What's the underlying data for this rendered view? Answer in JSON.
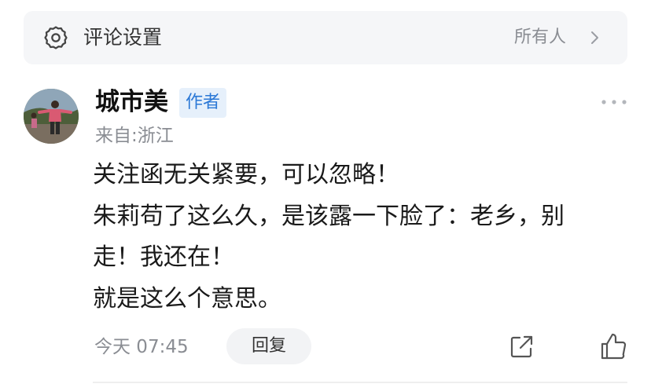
{
  "settings": {
    "label": "评论设置",
    "value": "所有人",
    "icon": "gear-icon",
    "chevron": "chevron-right-icon"
  },
  "comment": {
    "author": "城市美",
    "badge": "作者",
    "location": "来自:浙江",
    "lines": [
      "关注函无关紧要，可以忽略！",
      "朱莉苟了这么久，是该露一下脸了：老乡，别",
      "走！我还在！",
      "就是这么个意思。"
    ],
    "time": "今天 07:45",
    "reply_label": "回复",
    "more_icon": "more-dots-icon",
    "share_icon": "share-icon",
    "like_icon": "thumbs-up-icon"
  },
  "colors": {
    "badge_bg": "#e6f0fb",
    "badge_text": "#2b78d6",
    "muted": "#8a8d93",
    "bar_bg": "#f5f6f8"
  }
}
